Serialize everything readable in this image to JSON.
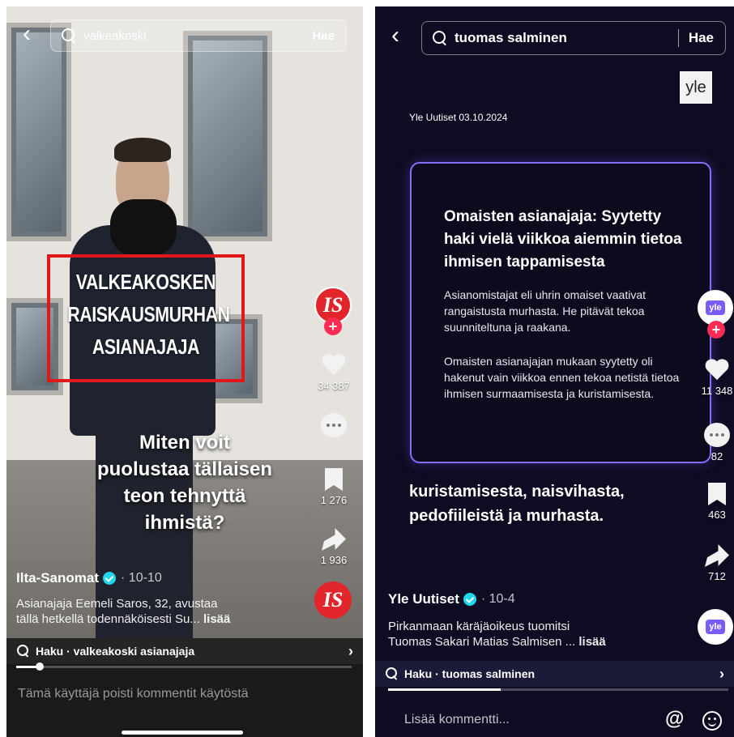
{
  "left": {
    "search": {
      "query": "valkeakoski",
      "button": "Hae"
    },
    "overlay_title": [
      "VALKEAKOSKEN",
      "RAISKAUSMURHAN",
      "ASIANAJAJA"
    ],
    "caption": [
      "Miten voit",
      "puolustaa tällaisen",
      "teon tehnyttä",
      "ihmistä?"
    ],
    "avatar_label": "IS",
    "actions": {
      "likes": "34 387",
      "saves": "1 276",
      "shares": "1 936"
    },
    "author": {
      "name": "Ilta-Sanomat",
      "date": "· 10-10"
    },
    "description": [
      "Asianajaja Eemeli Saros, 32, avustaa",
      "tällä hetkellä todennäköisesti Su..."
    ],
    "more_label": "lisää",
    "search_strip": "Haku · valkeakoski asianajaja",
    "progress": 0.07,
    "comment_notice": "Tämä käyttäjä poisti kommentit käytöstä"
  },
  "right": {
    "search": {
      "query": "tuomas salminen",
      "button": "Hae"
    },
    "logo": "yle",
    "source_date": "Yle Uutiset 03.10.2024",
    "card": {
      "title": "Omaisten asianajaja: Syytetty haki vielä viikkoa aiemmin tietoa ihmisen tappamisesta",
      "paragraphs": [
        "Asianomistajat eli uhrin omaiset vaativat rangaistusta murhasta. He pitävät tekoa suunniteltuna ja raakana.",
        "Omaisten asianajajan mukaan syytetty oli hakenut vain viikkoa ennen tekoa netistä tietoa ihmisen surmaamisesta ja kuristamisesta."
      ]
    },
    "caption": [
      "kuristamisesta, naisvihasta,",
      "pedofiileistä ja murhasta."
    ],
    "avatar_label": "yle",
    "actions": {
      "likes": "11 348",
      "comments": "82",
      "saves": "463",
      "shares": "712"
    },
    "author": {
      "name": "Yle Uutiset",
      "date": "· 10-4"
    },
    "description": [
      "Pirkanmaan käräjäoikeus tuomitsi",
      "Tuomas Sakari Matias Salmisen ..."
    ],
    "more_label": "lisää",
    "search_strip": "Haku · tuomas salminen",
    "progress": 0.33,
    "comment_placeholder": "Lisää kommentti...",
    "at_symbol": "@"
  }
}
